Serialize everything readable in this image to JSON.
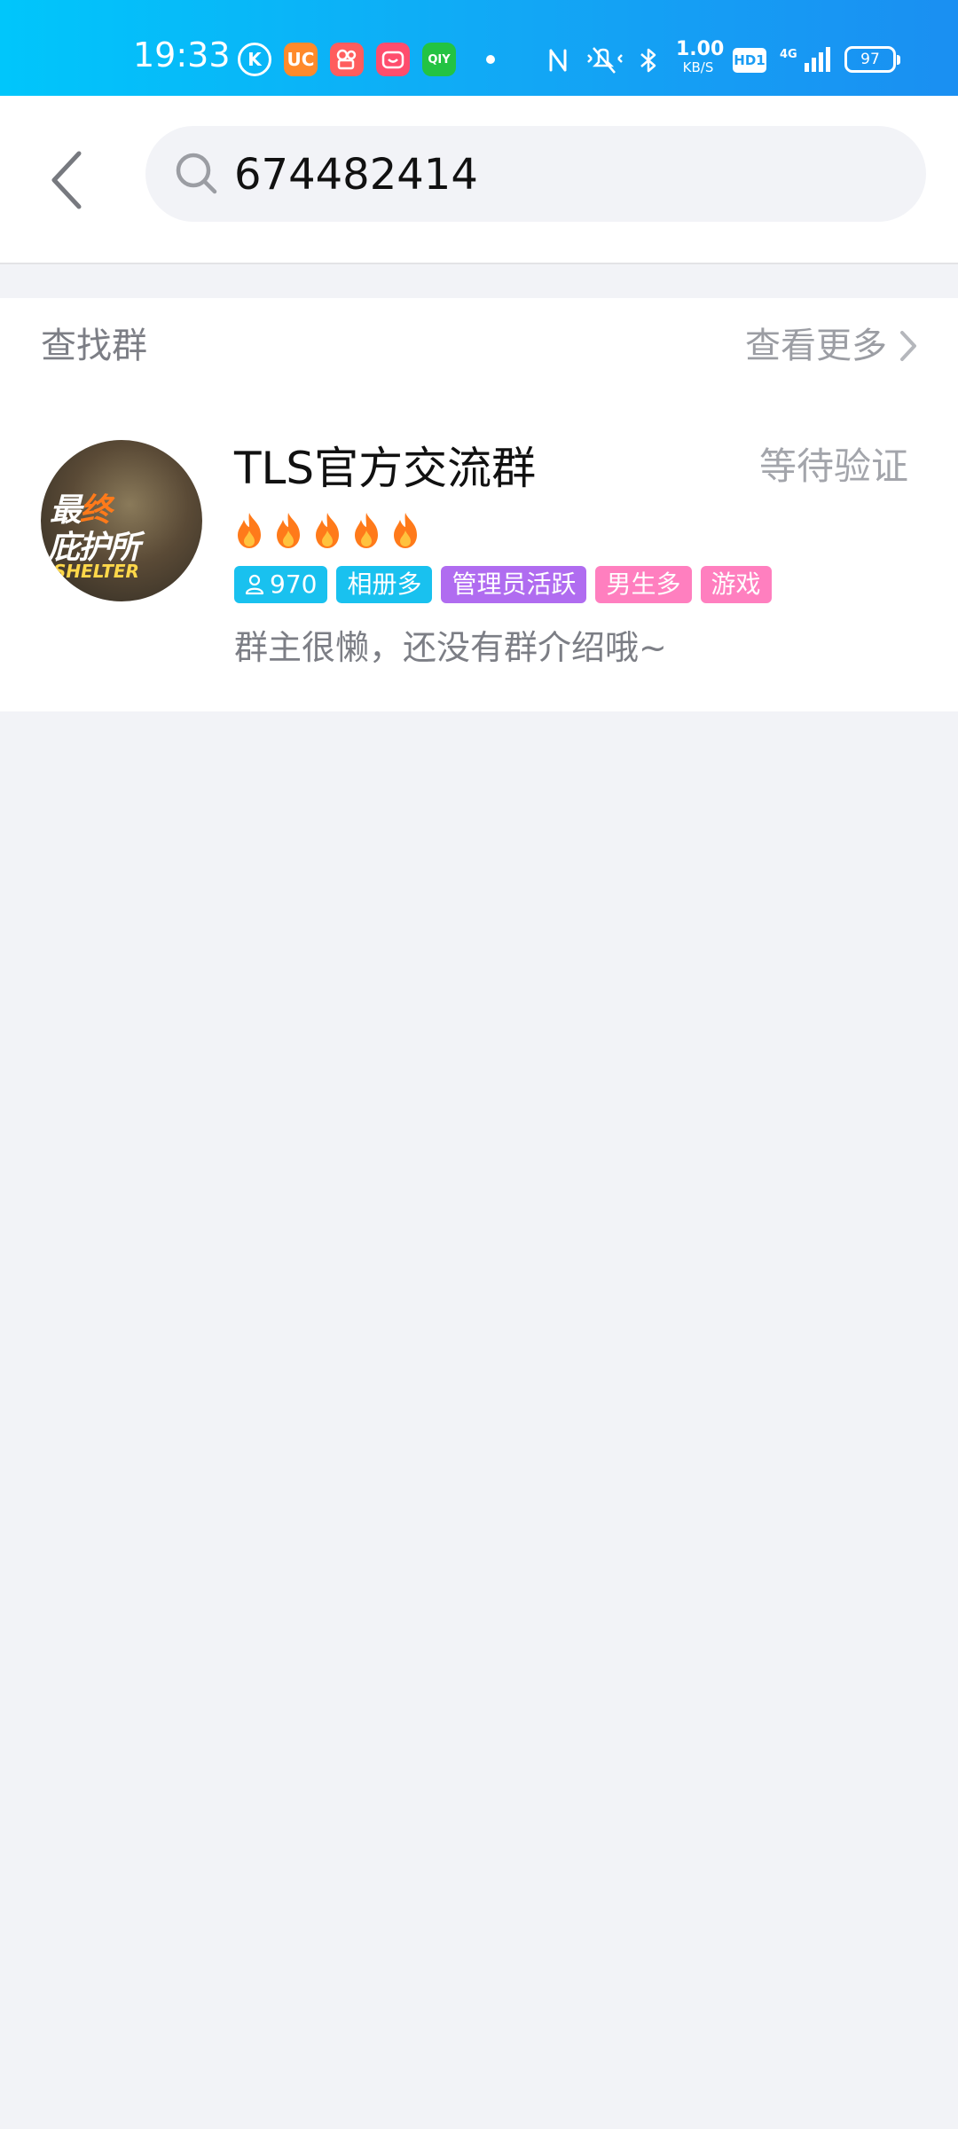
{
  "status_bar": {
    "time": "19:33",
    "app_icons": [
      "K",
      "UC",
      "",
      "",
      "QIY"
    ],
    "net_speed_value": "1.00",
    "net_speed_unit": "KB/S",
    "hd_label": "HD1",
    "battery": "97"
  },
  "search": {
    "value": "674482414"
  },
  "results": {
    "section_title": "查找群",
    "see_more": "查看更多",
    "groups": [
      {
        "name": "TLS官方交流群",
        "status": "等待验证",
        "flame_count": 5,
        "avatar_text": {
          "line1a": "最",
          "line1b": "终",
          "line2": "庇护所",
          "line3": "SHELTER"
        },
        "tags": [
          {
            "label": "970",
            "color": "#19c1ef",
            "icon": "person-icon"
          },
          {
            "label": "相册多",
            "color": "#19c1ef"
          },
          {
            "label": "管理员活跃",
            "color": "#b06cf0"
          },
          {
            "label": "男生多",
            "color": "#ff7fbf"
          },
          {
            "label": "游戏",
            "color": "#ff7fbf"
          }
        ],
        "description": "群主很懒，还没有群介绍哦~"
      }
    ]
  },
  "colors": {
    "status_gradient_start": "#00c6fb",
    "status_gradient_end": "#1a8ff2",
    "page_background": "#f2f3f7",
    "flame": "#ff7a1a"
  }
}
